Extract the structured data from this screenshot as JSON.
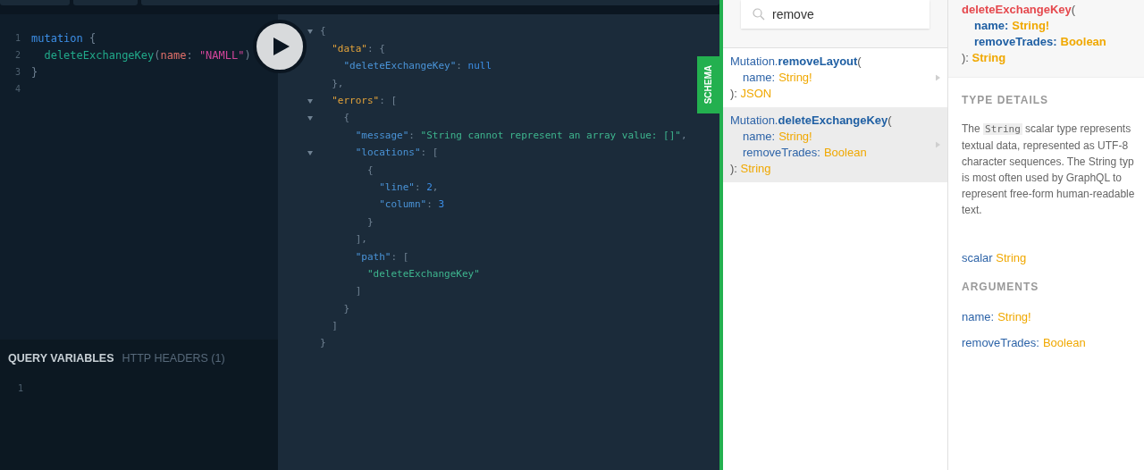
{
  "query_editor": {
    "lines": [
      {
        "number": "1",
        "tokens": [
          {
            "text": "mutation",
            "kind": "keyword"
          },
          {
            "text": " {",
            "kind": "punct"
          }
        ]
      },
      {
        "number": "2",
        "tokens": [
          {
            "text": "  deleteExchangeKey",
            "kind": "def"
          },
          {
            "text": "(",
            "kind": "punct"
          },
          {
            "text": "name",
            "kind": "attr"
          },
          {
            "text": ": ",
            "kind": "punct"
          },
          {
            "text": "\"NAMLL\"",
            "kind": "string"
          },
          {
            "text": ")",
            "kind": "punct"
          }
        ]
      },
      {
        "number": "3",
        "tokens": [
          {
            "text": "}",
            "kind": "punct"
          }
        ]
      },
      {
        "number": "4"
      }
    ]
  },
  "result_viewer": {
    "lines": [
      {
        "foldable": true,
        "tokens": [
          {
            "text": "{",
            "kind": "punct"
          }
        ]
      },
      {
        "foldable": false,
        "tokens": [
          {
            "text": "  \"data\"",
            "kind": "topkey"
          },
          {
            "text": ": {",
            "kind": "punct"
          }
        ]
      },
      {
        "foldable": false,
        "tokens": [
          {
            "text": "    \"deleteExchangeKey\"",
            "kind": "property"
          },
          {
            "text": ": ",
            "kind": "punct"
          },
          {
            "text": "null",
            "kind": "number"
          }
        ]
      },
      {
        "foldable": false,
        "tokens": [
          {
            "text": "  },",
            "kind": "punct"
          }
        ]
      },
      {
        "foldable": true,
        "tokens": [
          {
            "text": "  \"errors\"",
            "kind": "topkey"
          },
          {
            "text": ": [",
            "kind": "punct"
          }
        ]
      },
      {
        "foldable": true,
        "tokens": [
          {
            "text": "    {",
            "kind": "punct"
          }
        ]
      },
      {
        "foldable": false,
        "tokens": [
          {
            "text": "      \"message\"",
            "kind": "property"
          },
          {
            "text": ": ",
            "kind": "punct"
          },
          {
            "text": "\"String cannot represent an array value: []\"",
            "kind": "string"
          },
          {
            "text": ",",
            "kind": "punct"
          }
        ]
      },
      {
        "foldable": true,
        "tokens": [
          {
            "text": "      \"locations\"",
            "kind": "property"
          },
          {
            "text": ": [",
            "kind": "punct"
          }
        ]
      },
      {
        "foldable": false,
        "tokens": [
          {
            "text": "        {",
            "kind": "punct"
          }
        ]
      },
      {
        "foldable": false,
        "tokens": [
          {
            "text": "          \"line\"",
            "kind": "property"
          },
          {
            "text": ": ",
            "kind": "punct"
          },
          {
            "text": "2",
            "kind": "number"
          },
          {
            "text": ",",
            "kind": "punct"
          }
        ]
      },
      {
        "foldable": false,
        "tokens": [
          {
            "text": "          \"column\"",
            "kind": "property"
          },
          {
            "text": ": ",
            "kind": "punct"
          },
          {
            "text": "3",
            "kind": "number"
          }
        ]
      },
      {
        "foldable": false,
        "tokens": [
          {
            "text": "        }",
            "kind": "punct"
          }
        ]
      },
      {
        "foldable": false,
        "tokens": [
          {
            "text": "      ],",
            "kind": "punct"
          }
        ]
      },
      {
        "foldable": false,
        "tokens": [
          {
            "text": "      \"path\"",
            "kind": "property"
          },
          {
            "text": ": [",
            "kind": "punct"
          }
        ]
      },
      {
        "foldable": false,
        "tokens": [
          {
            "text": "        \"deleteExchangeKey\"",
            "kind": "string"
          }
        ]
      },
      {
        "foldable": false,
        "tokens": [
          {
            "text": "      ]",
            "kind": "punct"
          }
        ]
      },
      {
        "foldable": false,
        "tokens": [
          {
            "text": "    }",
            "kind": "punct"
          }
        ]
      },
      {
        "foldable": false,
        "tokens": [
          {
            "text": "  ]",
            "kind": "punct"
          }
        ]
      },
      {
        "foldable": false,
        "tokens": [
          {
            "text": "}",
            "kind": "punct"
          }
        ]
      }
    ]
  },
  "variables_pane": {
    "tabs": [
      {
        "label": "QUERY VARIABLES",
        "selected": true
      },
      {
        "label": "HTTP HEADERS (1)",
        "selected": false
      }
    ],
    "lines": [
      {
        "number": "1"
      }
    ]
  },
  "schema_tab": {
    "label": "SCHEMA"
  },
  "docs_search": {
    "value": "remove"
  },
  "search_results": [
    {
      "type_name": "Mutation.",
      "field": "removeLayout",
      "open": "(",
      "args": [
        {
          "name": "name:",
          "type": "String!"
        }
      ],
      "close": "):",
      "return_type": "JSON",
      "selected": false
    },
    {
      "type_name": "Mutation.",
      "field": "deleteExchangeKey",
      "open": "(",
      "args": [
        {
          "name": "name:",
          "type": "String!"
        },
        {
          "name": "removeTrades:",
          "type": "Boolean"
        }
      ],
      "close": "):",
      "return_type": "String",
      "selected": true
    }
  ],
  "type_panel": {
    "signature": {
      "field": "deleteExchangeKey",
      "open": "(",
      "args": [
        {
          "name": "name:",
          "type": "String!"
        },
        {
          "name": "removeTrades:",
          "type": "Boolean"
        }
      ],
      "close": "):",
      "return_type": "String"
    },
    "details_title": "TYPE DETAILS",
    "description": [
      [
        {
          "text": "The ",
          "kind": "text"
        },
        {
          "text": "String",
          "kind": "code"
        },
        {
          "text": " scalar type represents",
          "kind": "text"
        }
      ],
      [
        {
          "text": "textual data, represented as UTF-8",
          "kind": "text"
        }
      ],
      [
        {
          "text": "character sequences. The String typ",
          "kind": "text"
        }
      ],
      [
        {
          "text": "is most often used by GraphQL to",
          "kind": "text"
        }
      ],
      [
        {
          "text": "represent free-form human-readable",
          "kind": "text"
        }
      ],
      [
        {
          "text": "text.",
          "kind": "text"
        }
      ]
    ],
    "scalar_keyword": "scalar",
    "scalar_name": "String",
    "arguments_title": "ARGUMENTS",
    "arguments": [
      {
        "name": "name:",
        "type": "String!"
      },
      {
        "name": "removeTrades:",
        "type": "Boolean"
      }
    ]
  }
}
